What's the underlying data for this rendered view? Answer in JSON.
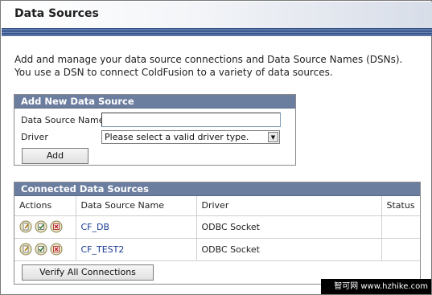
{
  "header": {
    "title": "Data Sources"
  },
  "intro": {
    "line1": "Add and manage your data source connections and Data Source Names (DSNs).",
    "line2": "You use a DSN to connect ColdFusion to a variety of data sources."
  },
  "add_panel": {
    "title": "Add New Data Source",
    "name_label": "Data Source Name",
    "name_value": "",
    "driver_label": "Driver",
    "driver_selected": "Please select a valid driver type.",
    "add_button": "Add"
  },
  "connected_panel": {
    "title": "Connected Data Sources",
    "columns": [
      "Actions",
      "Data Source Name",
      "Driver",
      "Status"
    ],
    "rows": [
      {
        "name": "CF_DB",
        "driver": "ODBC Socket",
        "status": ""
      },
      {
        "name": "CF_TEST2",
        "driver": "ODBC Socket",
        "status": ""
      }
    ],
    "verify_button": "Verify All Connections"
  },
  "watermark": {
    "text": "智可网 www.hzhike.com"
  },
  "icons": [
    "edit-icon",
    "verify-icon",
    "delete-icon"
  ],
  "colors": {
    "panel_header": "#6c7e9f",
    "stripe_dark": "#2b4a80",
    "link": "#1a3c8f"
  }
}
